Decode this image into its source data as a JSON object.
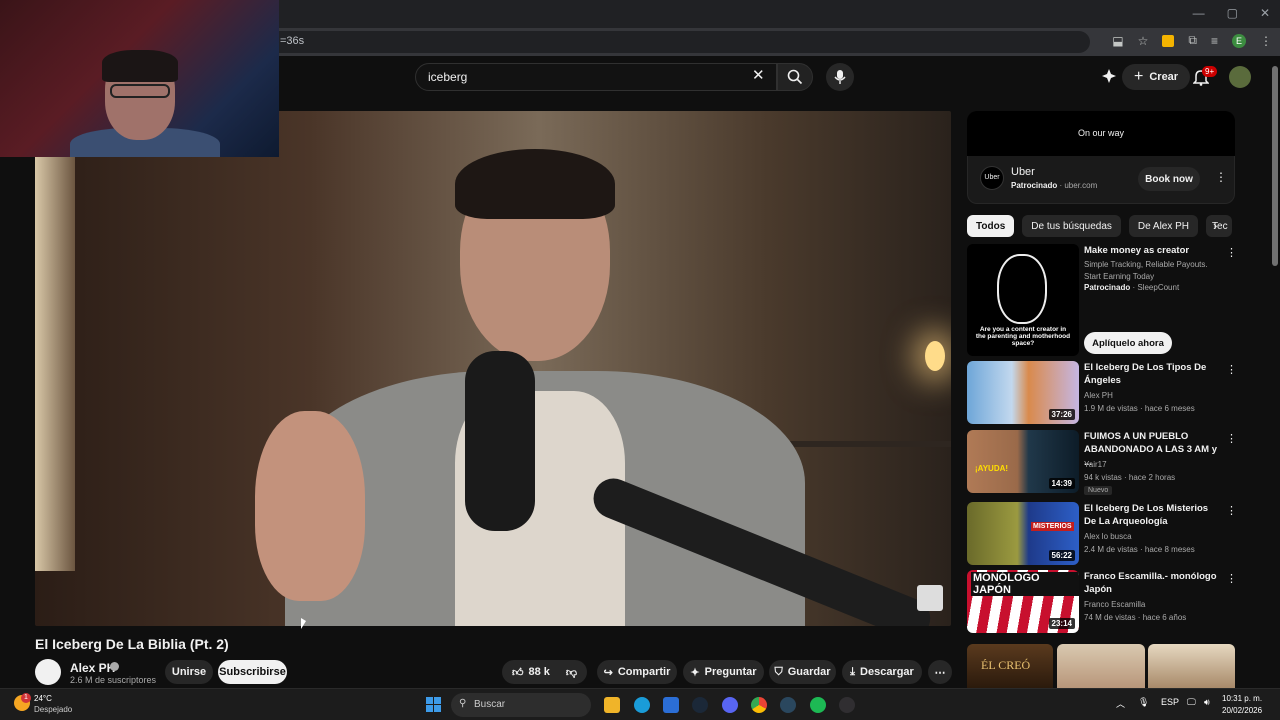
{
  "browser": {
    "url_fragment": "=36s",
    "profile_initial": "E"
  },
  "header": {
    "search_value": "iceberg",
    "create_label": "Crear",
    "notif_count": "9+"
  },
  "video": {
    "title": "El Iceberg De La Biblia (Pt. 2)",
    "channel": "Alex PH",
    "subscribers": "2.6 M de suscriptores",
    "join_label": "Unirse",
    "subscribe_label": "Subscribirse",
    "likes": "88 k",
    "share_label": "Compartir",
    "ask_label": "Preguntar",
    "save_label": "Guardar",
    "download_label": "Descargar"
  },
  "ad": {
    "banner_text": "On our way",
    "logo_text": "Uber",
    "title": "Uber",
    "sponsored": "Patrocinado",
    "domain": "· uber.com",
    "cta": "Book now"
  },
  "chips": [
    "Todos",
    "De tus búsquedas",
    "De Alex PH",
    "Tec"
  ],
  "ad_rec": {
    "title": "Make money as creator",
    "desc1": "Simple Tracking, Reliable Payouts.",
    "desc2": "Start Earning Today",
    "sponsored": "Patrocinado",
    "advertiser": "· SleepCount",
    "thumb_caption": "Are you a content creator in the parenting and motherhood space?",
    "cta": "Aplíquelo ahora"
  },
  "recommendations": [
    {
      "title": "El Iceberg De Los Tipos De Ángeles",
      "channel": "Alex PH",
      "meta": "1.9 M de vistas · hace 6 meses",
      "duration": "37:26",
      "badge": ""
    },
    {
      "title": "FUIMOS A UN PUEBLO ABANDONADO A LAS 3 AM y ...",
      "channel": "Yair17",
      "meta": "94 k vistas · hace 2 horas",
      "duration": "14:39",
      "badge": "Nuevo",
      "thumb_text": "¡AYUDA!"
    },
    {
      "title": "El Iceberg De Los Misterios De La Arqueología",
      "channel": "Alex lo busca",
      "meta": "2.4 M de vistas · hace 8 meses",
      "duration": "56:22",
      "badge": "",
      "thumb_text": "MISTERIOS"
    },
    {
      "title": "Franco Escamilla.- monólogo Japón",
      "channel": "Franco Escamilla",
      "meta": "74 M de vistas · hace 6 años",
      "duration": "23:14",
      "badge": "",
      "thumb_text": "MONÓLOGO JAPÓN"
    }
  ],
  "partial_thumb_text": "ÉL CREÓ",
  "taskbar": {
    "weather_temp": "24°C",
    "weather_desc": "Despejado",
    "weather_badge": "1",
    "search_placeholder": "Buscar",
    "lang": "ESP",
    "time": "10:31 p. m.",
    "date": "20/02/2026"
  },
  "colors": {
    "background": "#0f0f0f",
    "accent_red": "#cc0000",
    "chip_active": "#f1f1f1"
  }
}
